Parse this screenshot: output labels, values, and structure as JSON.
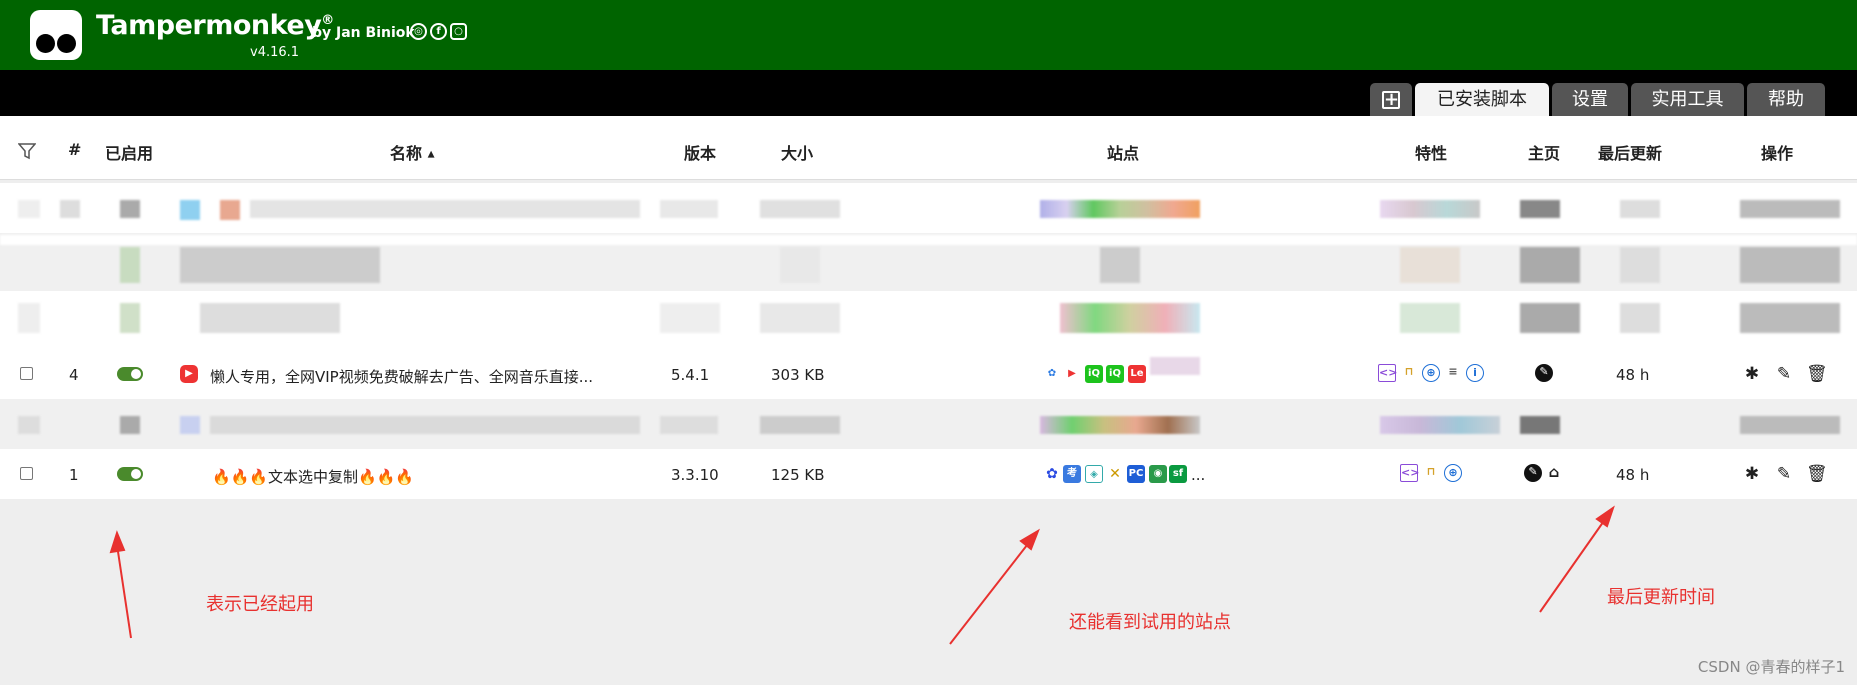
{
  "header": {
    "app_name": "Tampermonkey",
    "registered": "®",
    "by": "by Jan Biniok",
    "version": "v4.16.1"
  },
  "tabs": [
    {
      "label": "已安装脚本",
      "active": true
    },
    {
      "label": "设置",
      "active": false
    },
    {
      "label": "实用工具",
      "active": false
    },
    {
      "label": "帮助",
      "active": false
    }
  ],
  "columns": {
    "num": "#",
    "enabled": "已启用",
    "name": "名称",
    "sort_indicator": "▲",
    "version": "版本",
    "size": "大小",
    "sites": "站点",
    "features": "特性",
    "homepage": "主页",
    "updated": "最后更新",
    "actions": "操作"
  },
  "scripts": [
    {
      "index": "4",
      "name": "懒人专用，全网VIP视频免费破解去广告、全网音乐直接...",
      "version": "5.4.1",
      "size": "303 KB",
      "updated": "48 h",
      "enabled": true
    },
    {
      "index": "1",
      "name": "🔥🔥🔥文本选中复制🔥🔥🔥",
      "version": "3.3.10",
      "size": "125 KB",
      "updated": "48 h",
      "enabled": true,
      "sites_more": "..."
    }
  ],
  "site_icon_labels": {
    "kao": "考",
    "pc": "PC",
    "sf": "sf"
  },
  "annotations": {
    "enabled": "表示已经起用",
    "sites": "还能看到试用的站点",
    "updated": "最后更新时间"
  },
  "watermark": "CSDN @青春的样子1",
  "colors": {
    "header_bg": "#006400",
    "tabbar_bg": "#000000",
    "toggle_on": "#4a8a2c",
    "annotation": "#e8312f"
  }
}
